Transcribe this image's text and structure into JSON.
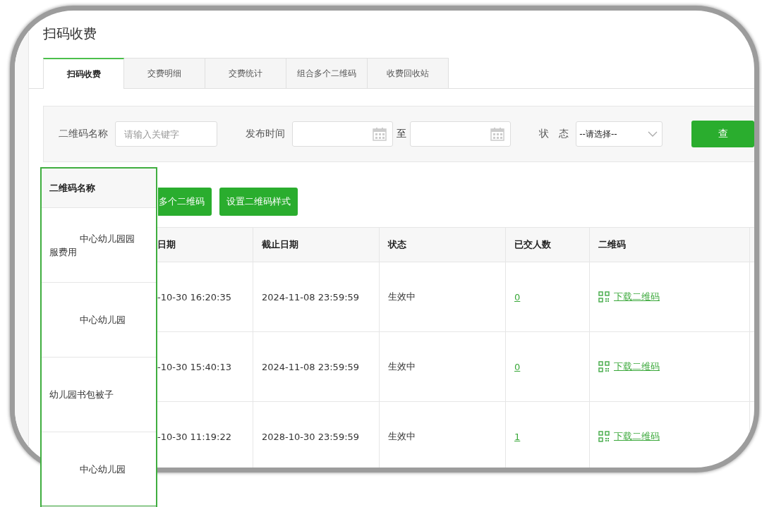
{
  "page_title": "扫码收费",
  "tabs": [
    {
      "label": "扫码收费",
      "selected": true
    },
    {
      "label": "交费明细",
      "selected": false
    },
    {
      "label": "交费统计",
      "selected": false
    },
    {
      "label": "组合多个二维码",
      "selected": false
    },
    {
      "label": "收费回收站",
      "selected": false
    }
  ],
  "filters": {
    "name_label": "二维码名称",
    "name_placeholder": "请输入关键字",
    "time_label": "发布时间",
    "to_label": "至",
    "status_label": "状　态",
    "status_value": "--请选择--",
    "search_button": "查"
  },
  "actions": [
    "多个二维码",
    "设置二维码样式"
  ],
  "table": {
    "columns": [
      "日期",
      "截止日期",
      "状态",
      "已交人数",
      "二维码"
    ],
    "rows": [
      {
        "start": "-10-30 16:20:35",
        "end": "2024-11-08 23:59:59",
        "status": "生效中",
        "paid": "0",
        "link": "下载二维码"
      },
      {
        "start": "-10-30 15:40:13",
        "end": "2024-11-08 23:59:59",
        "status": "生效中",
        "paid": "0",
        "link": "下载二维码"
      },
      {
        "start": "-10-30 11:19:22",
        "end": "2028-10-30 23:59:59",
        "status": "生效中",
        "paid": "1",
        "link": "下载二维码"
      }
    ]
  },
  "fixed_column": {
    "header": "二维码名称",
    "items": [
      {
        "name": "中心幼儿园园服费用",
        "indented": true
      },
      {
        "name": "中心幼儿园",
        "indented": true
      },
      {
        "name": "幼儿园书包被子",
        "indented": false
      },
      {
        "name": "中心幼儿园",
        "indented": true
      }
    ]
  }
}
